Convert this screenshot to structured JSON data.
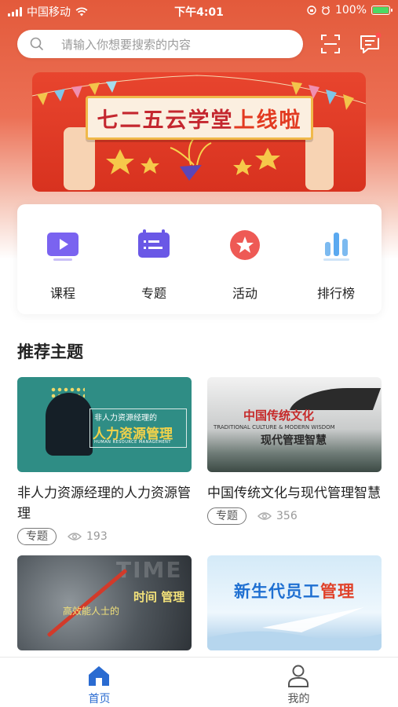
{
  "status_bar": {
    "carrier": "中国移动",
    "time": "下午4:01",
    "battery": "100%"
  },
  "search": {
    "placeholder": "请输入你想要搜索的内容",
    "icon": "search-icon"
  },
  "header_icons": [
    "scan-icon",
    "message-icon"
  ],
  "banner": {
    "text": "七二五云学堂",
    "highlight": "上线啦"
  },
  "quick_nav": [
    {
      "label": "课程",
      "icon": "video-icon",
      "color": "#7a63f0"
    },
    {
      "label": "专题",
      "icon": "topic-list-icon",
      "color": "#6a58e6"
    },
    {
      "label": "活动",
      "icon": "star-icon",
      "color": "#ee5a55"
    },
    {
      "label": "排行榜",
      "icon": "bar-chart-icon",
      "color": "#5aa9f0"
    }
  ],
  "section": {
    "title": "推荐主题"
  },
  "cards": [
    {
      "title": "非人力资源经理的人力资源管理",
      "tag": "专题",
      "views": "193",
      "thumb": {
        "sub": "非人力资源经理的",
        "main": "人力资源管理",
        "en": "HUMAN RESOURCE MANAGEMENT"
      }
    },
    {
      "title": "中国传统文化与现代管理智慧",
      "tag": "专题",
      "views": "356",
      "thumb": {
        "cn": "中国传统文化",
        "en": "TRADITIONAL CULTURE & MODERN WISDOM",
        "main": "现代管理智慧"
      }
    },
    {
      "title": "",
      "thumb": {
        "bg": "TIME",
        "a": "高效能人士的",
        "b": "时间 管理"
      }
    },
    {
      "title": "",
      "thumb": {
        "main": "新生代员工",
        "highlight": "管理"
      }
    }
  ],
  "tab_bar": [
    {
      "label": "首页",
      "icon": "home-icon",
      "active": true
    },
    {
      "label": "我的",
      "icon": "user-icon",
      "active": false
    }
  ],
  "colors": {
    "accent": "#2a6bd1",
    "hero": "#e35a3b",
    "inactive_tab": "#555555"
  }
}
